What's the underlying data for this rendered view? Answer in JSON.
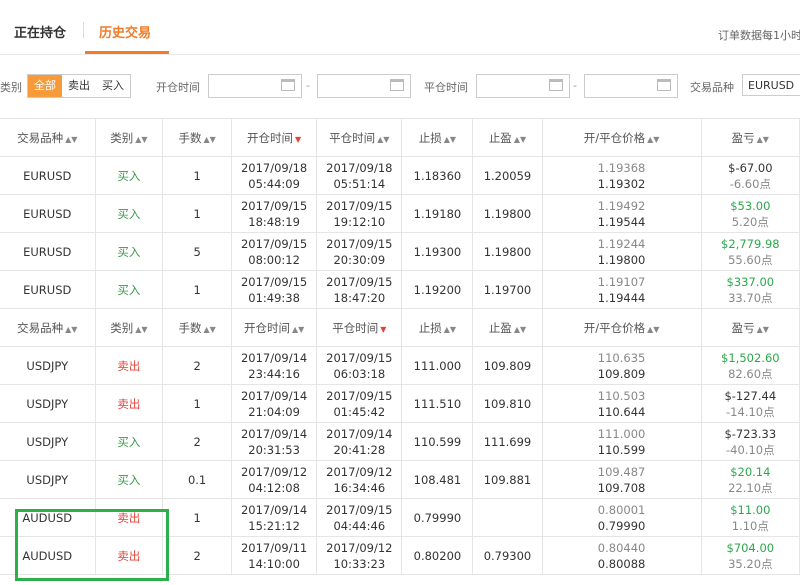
{
  "tabs": [
    {
      "label": "正在持仓"
    },
    {
      "label": "历史交易"
    }
  ],
  "notice": "订单数据每1小时",
  "filters": {
    "type_label": "类别",
    "type_options": [
      "全部",
      "卖出",
      "买入"
    ],
    "open_time_label": "开仓时间",
    "close_time_label": "平仓时间",
    "range_sep": "-",
    "symbol_label": "交易品种",
    "symbol_value": "EURUSD"
  },
  "headers": {
    "symbol": "交易品种",
    "type": "类别",
    "lots": "手数",
    "open_time": "开仓时间",
    "close_time": "平仓时间",
    "stop_loss": "止损",
    "take_profit": "止盈",
    "price": "开/平仓价格",
    "profit": "盈亏"
  },
  "groups": [
    {
      "rows": [
        {
          "symbol": "EURUSD",
          "type": "买入",
          "lots": "1",
          "open_date": "2017/09/18",
          "open_time": "05:44:09",
          "close_date": "2017/09/18",
          "close_time": "05:51:14",
          "sl": "1.18360",
          "tp": "1.20059",
          "open_price": "1.19368",
          "close_price": "1.19302",
          "profit": "$-67.00",
          "points": "-6.60点"
        },
        {
          "symbol": "EURUSD",
          "type": "买入",
          "lots": "1",
          "open_date": "2017/09/15",
          "open_time": "18:48:19",
          "close_date": "2017/09/15",
          "close_time": "19:12:10",
          "sl": "1.19180",
          "tp": "1.19800",
          "open_price": "1.19492",
          "close_price": "1.19544",
          "profit": "$53.00",
          "points": "5.20点"
        },
        {
          "symbol": "EURUSD",
          "type": "买入",
          "lots": "5",
          "open_date": "2017/09/15",
          "open_time": "08:00:12",
          "close_date": "2017/09/15",
          "close_time": "20:30:09",
          "sl": "1.19300",
          "tp": "1.19800",
          "open_price": "1.19244",
          "close_price": "1.19800",
          "profit": "$2,779.98",
          "points": "55.60点"
        },
        {
          "symbol": "EURUSD",
          "type": "买入",
          "lots": "1",
          "open_date": "2017/09/15",
          "open_time": "01:49:38",
          "close_date": "2017/09/15",
          "close_time": "18:47:20",
          "sl": "1.19200",
          "tp": "1.19700",
          "open_price": "1.19107",
          "close_price": "1.19444",
          "profit": "$337.00",
          "points": "33.70点"
        }
      ]
    },
    {
      "rows": [
        {
          "symbol": "USDJPY",
          "type": "卖出",
          "lots": "2",
          "open_date": "2017/09/14",
          "open_time": "23:44:16",
          "close_date": "2017/09/15",
          "close_time": "06:03:18",
          "sl": "111.000",
          "tp": "109.809",
          "open_price": "110.635",
          "close_price": "109.809",
          "profit": "$1,502.60",
          "points": "82.60点"
        },
        {
          "symbol": "USDJPY",
          "type": "卖出",
          "lots": "1",
          "open_date": "2017/09/14",
          "open_time": "21:04:09",
          "close_date": "2017/09/15",
          "close_time": "01:45:42",
          "sl": "111.510",
          "tp": "109.810",
          "open_price": "110.503",
          "close_price": "110.644",
          "profit": "$-127.44",
          "points": "-14.10点"
        },
        {
          "symbol": "USDJPY",
          "type": "买入",
          "lots": "2",
          "open_date": "2017/09/14",
          "open_time": "20:31:53",
          "close_date": "2017/09/14",
          "close_time": "20:41:28",
          "sl": "110.599",
          "tp": "111.699",
          "open_price": "111.000",
          "close_price": "110.599",
          "profit": "$-723.33",
          "points": "-40.10点"
        },
        {
          "symbol": "USDJPY",
          "type": "买入",
          "lots": "0.1",
          "open_date": "2017/09/12",
          "open_time": "04:12:08",
          "close_date": "2017/09/12",
          "close_time": "16:34:46",
          "sl": "108.481",
          "tp": "109.881",
          "open_price": "109.487",
          "close_price": "109.708",
          "profit": "$20.14",
          "points": "22.10点"
        },
        {
          "symbol": "AUDUSD",
          "type": "卖出",
          "lots": "1",
          "open_date": "2017/09/14",
          "open_time": "15:21:12",
          "close_date": "2017/09/15",
          "close_time": "04:44:46",
          "sl": "0.79990",
          "tp": "",
          "open_price": "0.80001",
          "close_price": "0.79990",
          "profit": "$11.00",
          "points": "1.10点"
        },
        {
          "symbol": "AUDUSD",
          "type": "卖出",
          "lots": "2",
          "open_date": "2017/09/11",
          "open_time": "14:10:00",
          "close_date": "2017/09/12",
          "close_time": "10:33:23",
          "sl": "0.80200",
          "tp": "0.79300",
          "open_price": "0.80440",
          "close_price": "0.80088",
          "profit": "$704.00",
          "points": "35.20点"
        }
      ]
    }
  ],
  "colors": {
    "accent": "#f07c2a",
    "buy": "#3a9a4a",
    "sell": "#e0453a",
    "profit_positive": "#2ba84a",
    "highlight": "#2db04b"
  }
}
